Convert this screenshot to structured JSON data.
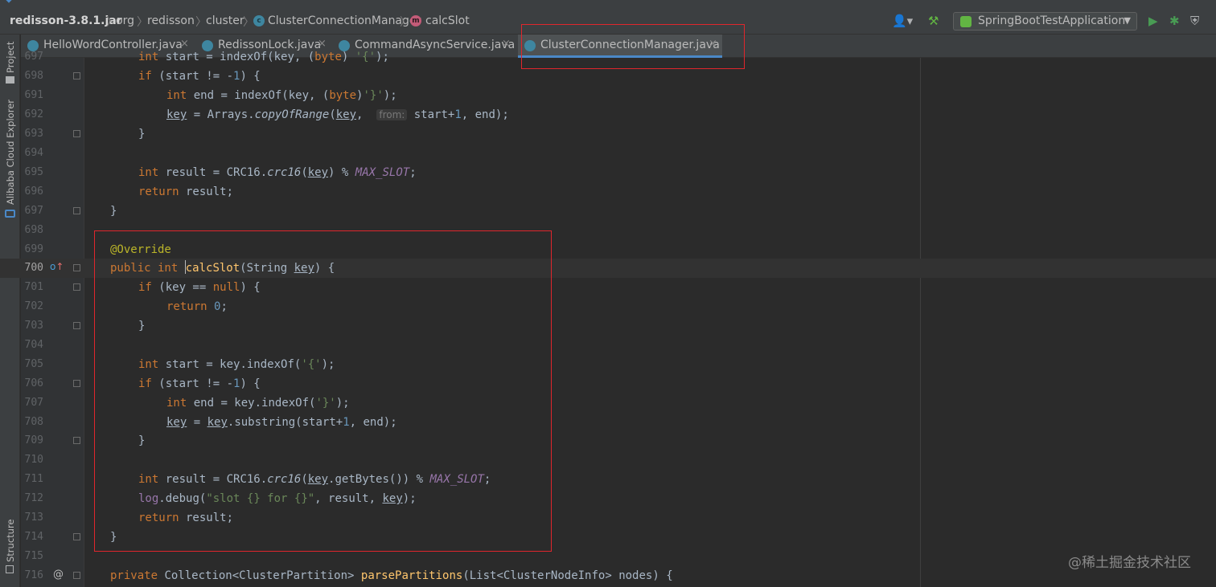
{
  "breadcrumb": {
    "jar": "redisson-3.8.1.jar",
    "items": [
      "org",
      "redisson",
      "cluster",
      "ClusterConnectionManager",
      "calcSlot"
    ]
  },
  "run_config": {
    "label": "SpringBootTestApplication"
  },
  "tool_windows": {
    "project": "Project",
    "cloud": "Alibaba Cloud Explorer",
    "structure": "Structure"
  },
  "tabs": [
    {
      "label": "HelloWordController.java"
    },
    {
      "label": "RedissonLock.java"
    },
    {
      "label": "CommandAsyncService.java"
    },
    {
      "label": "ClusterConnectionManager.java",
      "active": true
    }
  ],
  "lines": [
    {
      "n": "697"
    },
    {
      "n": "698"
    },
    {
      "n": "691"
    },
    {
      "n": "692"
    },
    {
      "n": "693"
    },
    {
      "n": "694"
    },
    {
      "n": "695"
    },
    {
      "n": "696"
    },
    {
      "n": "697"
    },
    {
      "n": "698"
    },
    {
      "n": "699"
    },
    {
      "n": "700"
    },
    {
      "n": "701"
    },
    {
      "n": "702"
    },
    {
      "n": "703"
    },
    {
      "n": "704"
    },
    {
      "n": "705"
    },
    {
      "n": "706"
    },
    {
      "n": "707"
    },
    {
      "n": "708"
    },
    {
      "n": "709"
    },
    {
      "n": "710"
    },
    {
      "n": "711"
    },
    {
      "n": "712"
    },
    {
      "n": "713"
    },
    {
      "n": "714"
    },
    {
      "n": "715"
    },
    {
      "n": "716"
    }
  ],
  "inlay_hint": "from:",
  "watermark": "@稀土掘金技术社区",
  "colors": {
    "keyword": "#cc7832",
    "number": "#6897bb",
    "string": "#6a8759",
    "annotation": "#bbb529",
    "method": "#ffc66d",
    "constant": "#9876aa",
    "highlight_box": "#e0262c",
    "active_tab": "#4a88c7"
  }
}
